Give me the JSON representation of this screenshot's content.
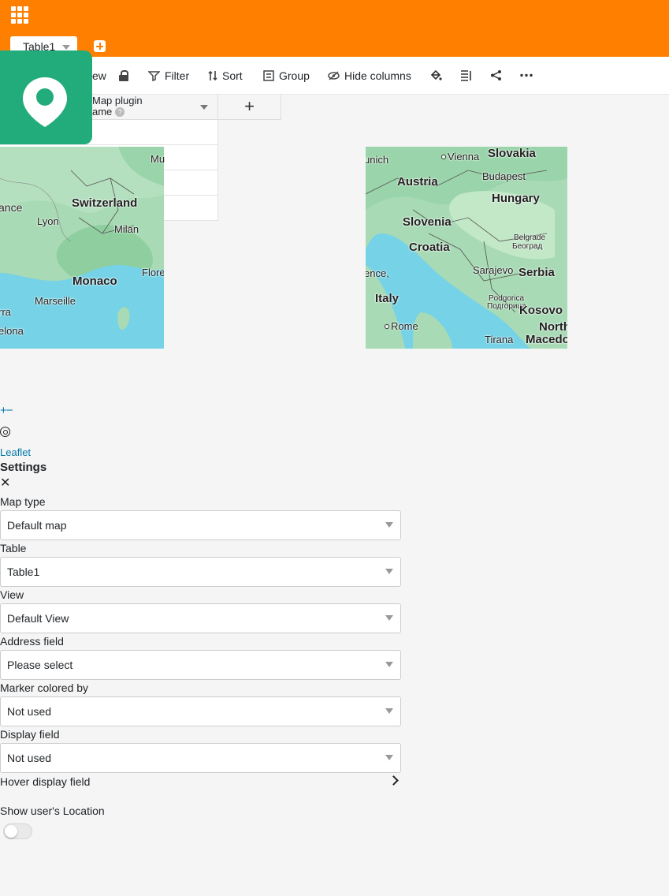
{
  "header": {
    "table_tab": "Table1",
    "colors": {
      "accent": "#ff8000",
      "plugin": "#22ac7c"
    }
  },
  "toolbar": {
    "view_fragment": "ew",
    "filter": "Filter",
    "sort": "Sort",
    "group": "Group",
    "hide_columns": "Hide columns"
  },
  "grid": {
    "column_line1": "Map plugin",
    "column_line2": "ame",
    "help": "?",
    "add_column": "+",
    "row1_fragment": "Mu"
  },
  "map_left": {
    "labels": [
      "ance",
      "Switzerland",
      "Lyon",
      "Milan",
      "Monaco",
      "Flore",
      "Marseille",
      "rra",
      "elona"
    ]
  },
  "map_right": {
    "labels": [
      "unich",
      "Vienna",
      "Slovakia",
      "Austria",
      "Budapest",
      "Hungary",
      "Slovenia",
      "Belgrade",
      "Београд",
      "Croatia",
      "ence,",
      "Sarajevo",
      "Serbia",
      "Italy",
      "Podgorica",
      "Подгорица",
      "Kosovo",
      "Rome",
      "North",
      "Tirana",
      "Macedon"
    ]
  },
  "leaflet": {
    "zoom": "+−",
    "attribution": "Leaflet"
  },
  "settings": {
    "title": "Settings",
    "close": "✕",
    "map_type": {
      "label": "Map type",
      "value": "Default map"
    },
    "table": {
      "label": "Table",
      "value": "Table1"
    },
    "view": {
      "label": "View",
      "value": "Default View"
    },
    "address_field": {
      "label": "Address field",
      "value": "Please select"
    },
    "marker_colored_by": {
      "label": "Marker colored by",
      "value": "Not used"
    },
    "display_field": {
      "label": "Display field",
      "value": "Not used"
    },
    "hover_display_field": {
      "label": "Hover display field"
    },
    "show_location": {
      "label": "Show user's Location",
      "enabled": false
    }
  }
}
